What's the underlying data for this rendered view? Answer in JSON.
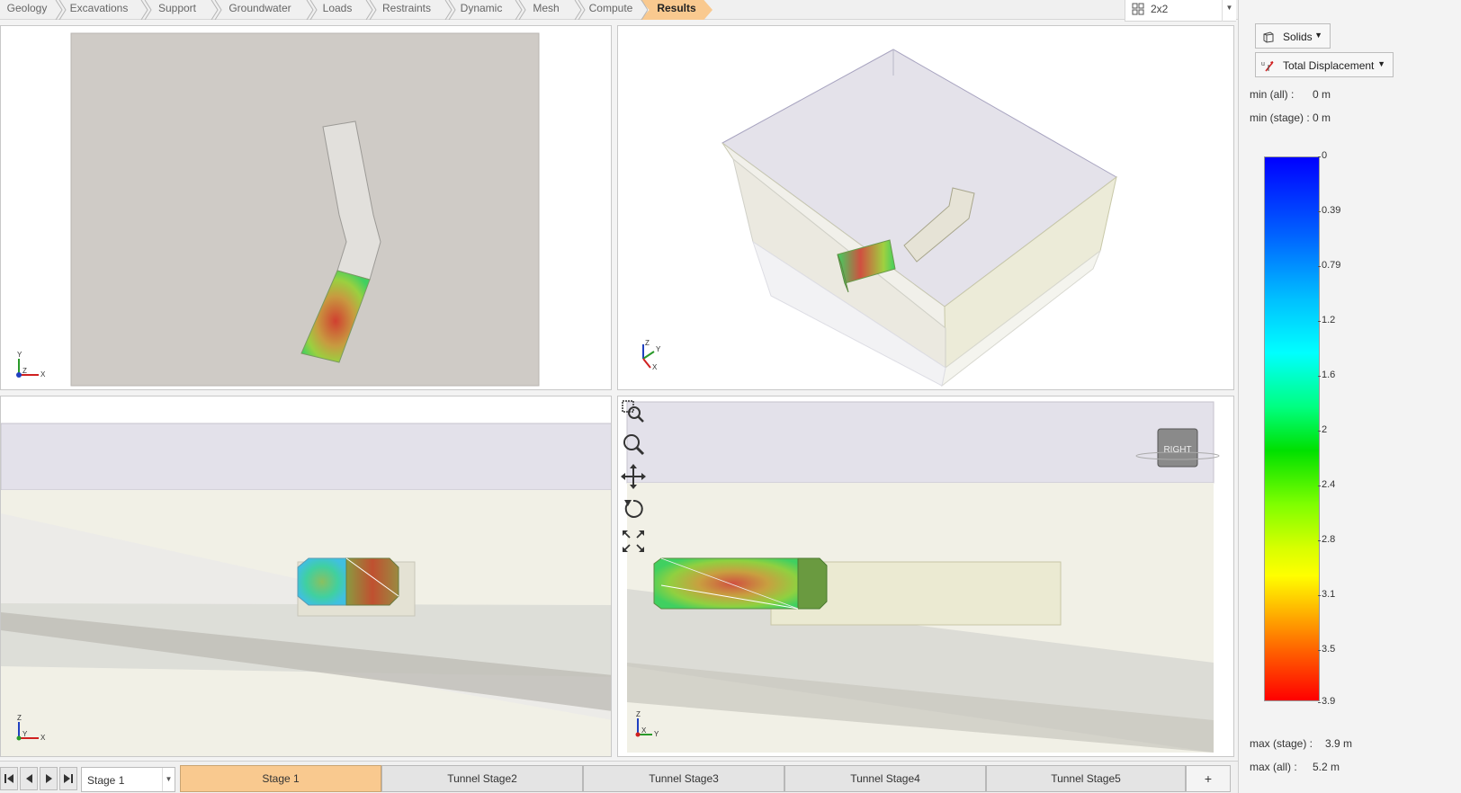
{
  "workflow": {
    "tabs": [
      {
        "label": "Geology",
        "active": false
      },
      {
        "label": "Excavations",
        "active": false
      },
      {
        "label": "Support",
        "active": false
      },
      {
        "label": "Groundwater",
        "active": false
      },
      {
        "label": "Loads",
        "active": false
      },
      {
        "label": "Restraints",
        "active": false
      },
      {
        "label": "Dynamic",
        "active": false
      },
      {
        "label": "Mesh",
        "active": false
      },
      {
        "label": "Compute",
        "active": false
      },
      {
        "label": "Results",
        "active": true
      }
    ],
    "layout_value": "2x2"
  },
  "viewports": {
    "top_left": {
      "axis_labels": [
        "Y",
        "Z",
        "X"
      ]
    },
    "top_right": {
      "axis_labels": [
        "Z",
        "Y",
        "X"
      ]
    },
    "bottom_left": {
      "axis_labels": [
        "Z",
        "Y",
        "X"
      ]
    },
    "bottom_right": {
      "axis_labels": [
        "Z",
        "X",
        "Y"
      ],
      "view_cube_label": "RIGHT"
    }
  },
  "nav_tools": [
    "zoom-window-icon",
    "zoom-icon",
    "pan-icon",
    "rotate-icon",
    "fit-extents-icon"
  ],
  "stagebar": {
    "current_stage": "Stage 1",
    "tabs": [
      {
        "label": "Stage 1",
        "active": true
      },
      {
        "label": "Tunnel Stage2",
        "active": false
      },
      {
        "label": "Tunnel Stage3",
        "active": false
      },
      {
        "label": "Tunnel Stage4",
        "active": false
      },
      {
        "label": "Tunnel Stage5",
        "active": false
      }
    ],
    "add_label": "+"
  },
  "side": {
    "render_mode": "Solids",
    "result_type": "Total Displacement",
    "min_all_label": "min (all) :",
    "min_all_value": "0 m",
    "min_stage_label": "min (stage) :",
    "min_stage_value": "0 m",
    "legend_ticks": [
      "0",
      "0.39",
      "0.79",
      "1.2",
      "1.6",
      "2",
      "2.4",
      "2.8",
      "3.1",
      "3.5",
      "3.9"
    ],
    "max_stage_label": "max (stage) :",
    "max_stage_value": "3.9 m",
    "max_all_label": "max (all) :",
    "max_all_value": "5.2 m"
  },
  "colors": {
    "active_tab": "#f9c98f",
    "panel_bg": "#f3f3f3"
  }
}
